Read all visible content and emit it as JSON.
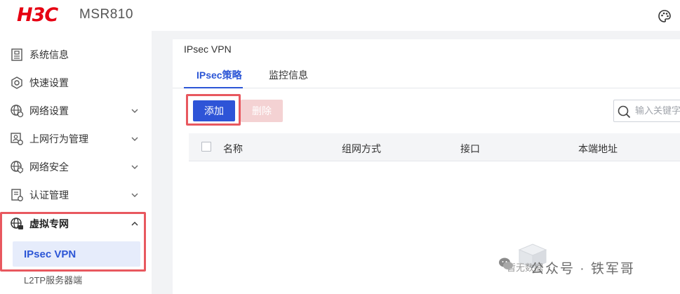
{
  "header": {
    "logo_text": "H3C",
    "model": "MSR810",
    "theme_icon": "palette-icon"
  },
  "sidebar": {
    "items": [
      {
        "label": "系统信息",
        "icon": "system-info-icon",
        "has_arrow": false
      },
      {
        "label": "快速设置",
        "icon": "hexagon-icon",
        "has_arrow": false
      },
      {
        "label": "网络设置",
        "icon": "globe-gear-icon",
        "has_arrow": true
      },
      {
        "label": "上网行为管理",
        "icon": "behavior-icon",
        "has_arrow": true
      },
      {
        "label": "网络安全",
        "icon": "globe-shield-icon",
        "has_arrow": true
      },
      {
        "label": "认证管理",
        "icon": "auth-icon",
        "has_arrow": true
      },
      {
        "label": "虚拟专网",
        "icon": "globe-vpn-icon",
        "has_arrow": true,
        "expanded": true
      }
    ],
    "sub_items": [
      {
        "label": "IPsec VPN",
        "active": true
      },
      {
        "label": "L2TP服务器端",
        "active": false
      }
    ]
  },
  "main": {
    "breadcrumb": "IPsec VPN",
    "tabs": [
      {
        "label": "IPsec策略",
        "active": true
      },
      {
        "label": "监控信息",
        "active": false
      }
    ],
    "toolbar": {
      "add_label": "添加",
      "delete_label": "删除",
      "search_placeholder": "输入关键字"
    },
    "table": {
      "columns": [
        "名称",
        "组网方式",
        "接口",
        "本端地址"
      ]
    },
    "empty_text": "暂无数据"
  },
  "watermark": {
    "text": "公众号 · 铁军哥"
  },
  "colors": {
    "brand_red": "#e60012",
    "accent_blue": "#2e54d7",
    "highlight_red": "#e8585f"
  }
}
